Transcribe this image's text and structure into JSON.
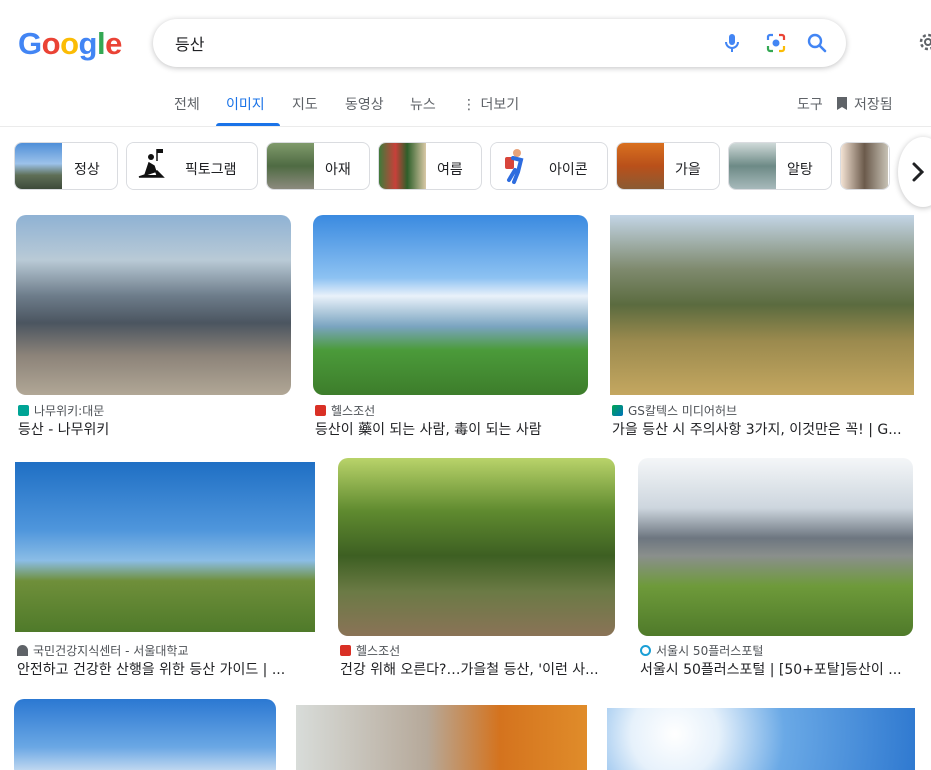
{
  "logo": {
    "letters": [
      "G",
      "o",
      "o",
      "g",
      "l",
      "e"
    ],
    "colors": [
      "#4285F4",
      "#EA4335",
      "#FBBC05",
      "#4285F4",
      "#34A853",
      "#EA4335"
    ]
  },
  "search": {
    "query": "등산"
  },
  "tabs": [
    {
      "label": "전체"
    },
    {
      "label": "이미지",
      "active": true
    },
    {
      "label": "지도"
    },
    {
      "label": "동영상"
    },
    {
      "label": "뉴스"
    },
    {
      "label": "⋮ 더보기"
    }
  ],
  "tools_label": "도구",
  "saved_label": "저장됨",
  "chips": [
    {
      "label": "정상"
    },
    {
      "label": "픽토그램"
    },
    {
      "label": "아재"
    },
    {
      "label": "여름"
    },
    {
      "label": "아이콘"
    },
    {
      "label": "가을"
    },
    {
      "label": "알탕"
    },
    {
      "label": ""
    }
  ],
  "results": [
    {
      "source": "나무위키:대문",
      "title": "등산 - 나무위키"
    },
    {
      "source": "헬스조선",
      "title": "등산이 藥이 되는 사람, 毒이 되는 사람"
    },
    {
      "source": "GS칼텍스 미디어허브",
      "title": "가을 등산 시 주의사항 3가지, 이것만은 꼭! | G..."
    },
    {
      "source": "국민건강지식센터 - 서울대학교",
      "title": "안전하고 건강한 산행을 위한 등산 가이드 | ..."
    },
    {
      "source": "헬스조선",
      "title": "건강 위해 오른다?…가을철 등산, '이런 사..."
    },
    {
      "source": "서울시 50플러스포털",
      "title": "서울시 50플러스포털 | [50+포탈]등산이 ..."
    },
    {
      "source": "",
      "title": ""
    },
    {
      "source": "",
      "title": ""
    },
    {
      "source": "",
      "title": ""
    }
  ],
  "colors": {
    "accent": "#1a73e8",
    "text": "#202124",
    "muted": "#5f6368"
  }
}
